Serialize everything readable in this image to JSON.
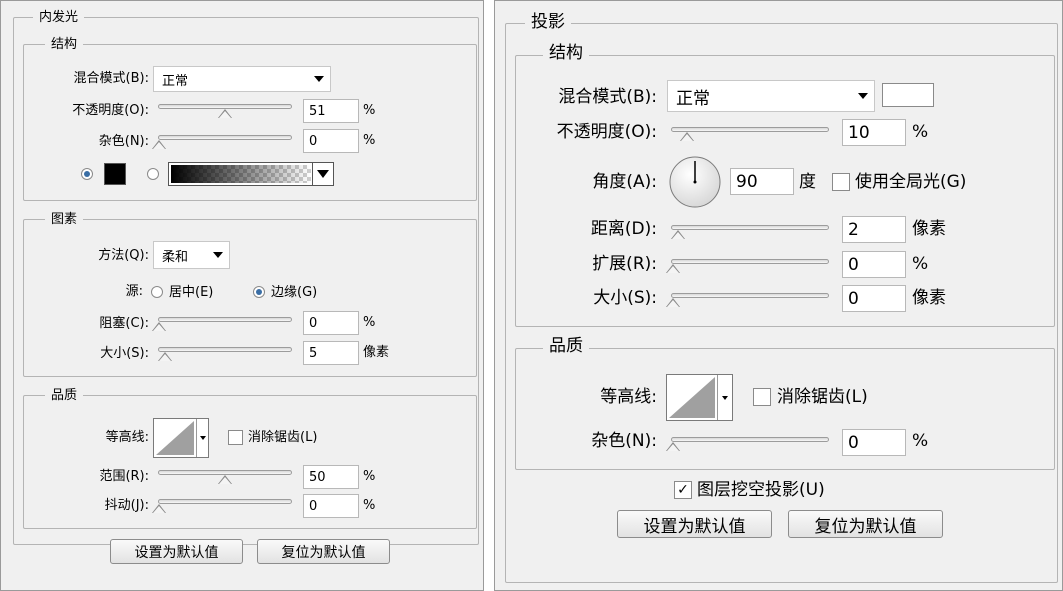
{
  "inner_glow": {
    "title": "内发光",
    "structure": {
      "title": "结构",
      "blend_mode_label": "混合模式(B):",
      "blend_mode_value": "正常",
      "opacity_label": "不透明度(O):",
      "opacity_value": "51",
      "opacity_fraction": 0.51,
      "opacity_unit": "%",
      "noise_label": "杂色(N):",
      "noise_value": "0",
      "noise_fraction": 0,
      "noise_unit": "%",
      "color_swatch": "#000000"
    },
    "elements": {
      "title": "图素",
      "technique_label": "方法(Q):",
      "technique_value": "柔和",
      "source_label": "源:",
      "source_center_label": "居中(E)",
      "source_edge_label": "边缘(G)",
      "choke_label": "阻塞(C):",
      "choke_value": "0",
      "choke_fraction": 0,
      "choke_unit": "%",
      "size_label": "大小(S):",
      "size_value": "5",
      "size_fraction": 0.02,
      "size_unit": "像素"
    },
    "quality": {
      "title": "品质",
      "contour_label": "等高线:",
      "antialias_label": "消除锯齿(L)",
      "range_label": "范围(R):",
      "range_value": "50",
      "range_fraction": 0.5,
      "range_unit": "%",
      "jitter_label": "抖动(J):",
      "jitter_value": "0",
      "jitter_fraction": 0,
      "jitter_unit": "%"
    },
    "make_default_label": "设置为默认值",
    "reset_default_label": "复位为默认值"
  },
  "drop_shadow": {
    "title": "投影",
    "structure": {
      "title": "结构",
      "blend_mode_label": "混合模式(B):",
      "blend_mode_value": "正常",
      "color_swatch": "#ffffff",
      "opacity_label": "不透明度(O):",
      "opacity_value": "10",
      "opacity_fraction": 0.1,
      "opacity_unit": "%",
      "angle_label": "角度(A):",
      "angle_value": "90",
      "angle_unit": "度",
      "global_light_label": "使用全局光(G)",
      "distance_label": "距离(D):",
      "distance_value": "2",
      "distance_fraction": 0.02,
      "distance_unit": "像素",
      "spread_label": "扩展(R):",
      "spread_value": "0",
      "spread_fraction": 0,
      "spread_unit": "%",
      "size_label": "大小(S):",
      "size_value": "0",
      "size_fraction": 0,
      "size_unit": "像素"
    },
    "quality": {
      "title": "品质",
      "contour_label": "等高线:",
      "antialias_label": "消除锯齿(L)",
      "noise_label": "杂色(N):",
      "noise_value": "0",
      "noise_fraction": 0,
      "noise_unit": "%"
    },
    "knockout_label": "图层挖空投影(U)",
    "knockout_checked": true,
    "make_default_label": "设置为默认值",
    "reset_default_label": "复位为默认值"
  },
  "colors": {
    "panel_bg": "#f0f0f0",
    "radio_accent": "#3a6ea5"
  }
}
